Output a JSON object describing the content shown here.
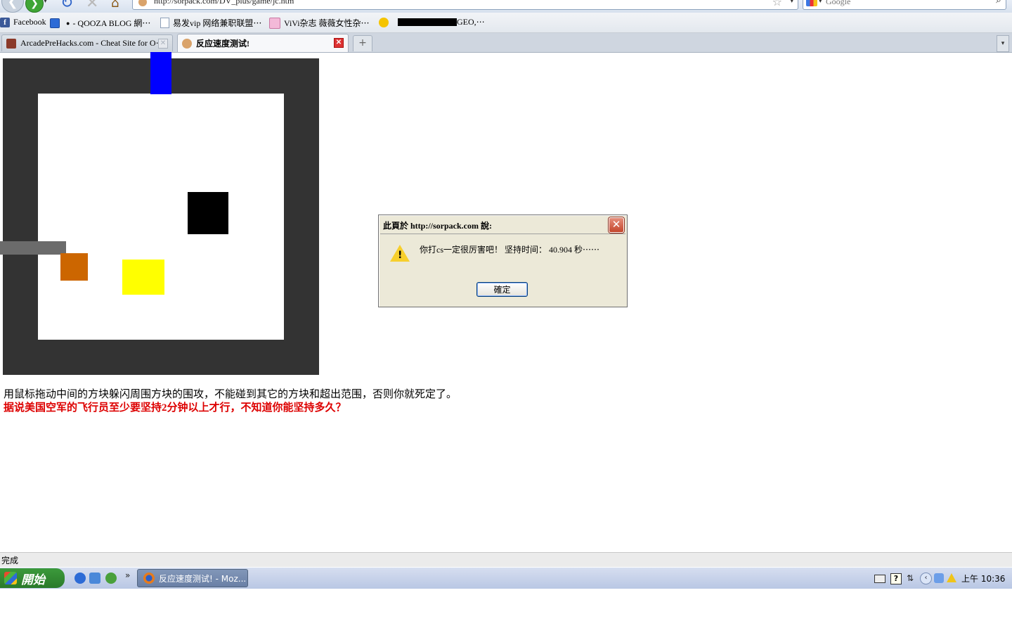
{
  "browser": {
    "url": "http://sorpack.com/DV_plus/game/jc.htm",
    "search_placeholder": "Google",
    "bookmarks": [
      {
        "label": "Facebook"
      },
      {
        "label": "- QOOZA BLOG 網⋯"
      },
      {
        "label": "易发vip 网络兼职联盟⋯"
      },
      {
        "label": "ViVi杂志 薇薇女性杂⋯"
      },
      {
        "label": "GEO,⋯"
      }
    ],
    "tabs": [
      {
        "label": "ArcadePreHacks.com - Cheat Site for O⋯",
        "active": false
      },
      {
        "label": "反应速度测试!",
        "active": true
      }
    ],
    "status": "完成"
  },
  "page": {
    "instructions": "用鼠标拖动中间的方块躲闪周围方块的围攻，不能碰到其它的方块和超出范围，否则你就死定了。",
    "challenge": "据说美国空军的飞行员至少要坚持2分钟以上才行，不知道你能坚持多久？"
  },
  "game": {
    "colors": {
      "board": "#333333",
      "arena": "#ffffff",
      "player": "#cc6600",
      "enemy_blue": "#0000ff",
      "enemy_black": "#000000",
      "enemy_gray": "#6b6b6b",
      "enemy_yellow": "#ffff00"
    }
  },
  "dialog": {
    "title": "此頁於 http://sorpack.com 說:",
    "message": "你打cs一定很厉害吧！ 坚持时间： 40.904 秒⋯⋯",
    "ok_label": "確定",
    "icon": "warning-icon"
  },
  "taskbar": {
    "start_label": "開始",
    "task_label": "反应速度测试! - Moz...",
    "clock": "上午 10:36"
  }
}
